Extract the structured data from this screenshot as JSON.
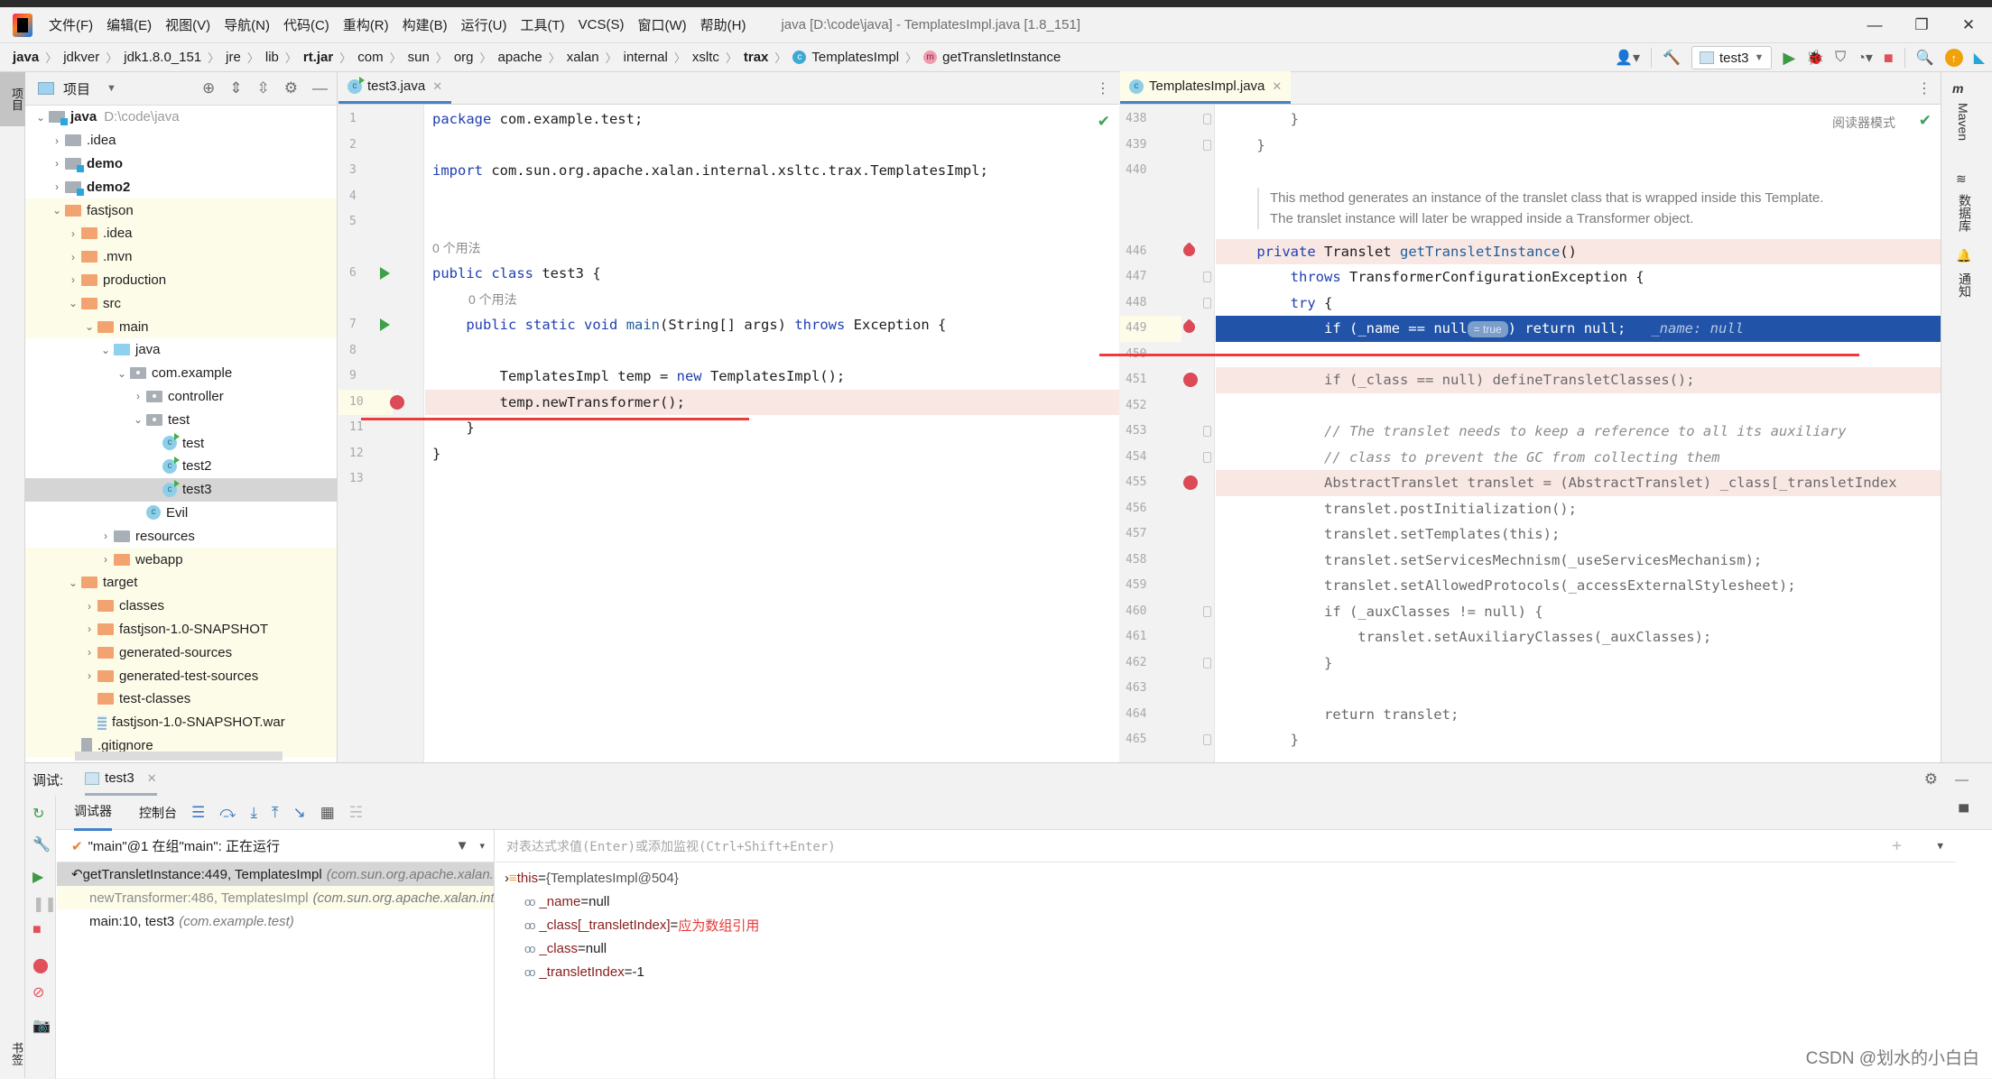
{
  "menubar": {
    "items": [
      "文件(F)",
      "编辑(E)",
      "视图(V)",
      "导航(N)",
      "代码(C)",
      "重构(R)",
      "构建(B)",
      "运行(U)",
      "工具(T)",
      "VCS(S)",
      "窗口(W)",
      "帮助(H)"
    ],
    "window_title": "java [D:\\code\\java] - TemplatesImpl.java [1.8_151]",
    "controls": {
      "minimize": "—",
      "restore": "❐",
      "close": "✕"
    }
  },
  "navbar": {
    "breadcrumbs": [
      "java",
      "jdkver",
      "jdk1.8.0_151",
      "jre",
      "lib",
      "rt.jar",
      "com",
      "sun",
      "org",
      "apache",
      "xalan",
      "internal",
      "xsltc",
      "trax"
    ],
    "class_crumb": "TemplatesImpl",
    "method_crumb": "getTransletInstance",
    "run_config": "test3"
  },
  "left_stripe": {
    "project_tab": "项目",
    "bookmarks_tab": "书签"
  },
  "project": {
    "header": "项目",
    "tree": [
      {
        "label": "java",
        "extra": "D:\\code\\java",
        "depth": 0,
        "icon": "module-folder",
        "open": true,
        "bold": true
      },
      {
        "label": ".idea",
        "depth": 1,
        "icon": "grey-folder",
        "open": false
      },
      {
        "label": "demo",
        "depth": 1,
        "icon": "module-folder",
        "open": false,
        "bold": true
      },
      {
        "label": "demo2",
        "depth": 1,
        "icon": "module-folder",
        "open": false,
        "bold": true
      },
      {
        "label": "fastjson",
        "depth": 1,
        "icon": "orange-folder",
        "open": true,
        "yellow": true
      },
      {
        "label": ".idea",
        "depth": 2,
        "icon": "orange-folder",
        "open": false,
        "yellow": true
      },
      {
        "label": ".mvn",
        "depth": 2,
        "icon": "orange-folder",
        "open": false,
        "yellow": true
      },
      {
        "label": "production",
        "depth": 2,
        "icon": "orange-folder",
        "open": false,
        "yellow": true
      },
      {
        "label": "src",
        "depth": 2,
        "icon": "orange-folder",
        "open": true,
        "yellow": true
      },
      {
        "label": "main",
        "depth": 3,
        "icon": "orange-folder",
        "open": true,
        "yellow": true
      },
      {
        "label": "java",
        "depth": 4,
        "icon": "blue-folder",
        "open": true
      },
      {
        "label": "com.example",
        "depth": 5,
        "icon": "package",
        "open": true
      },
      {
        "label": "controller",
        "depth": 6,
        "icon": "package",
        "open": false
      },
      {
        "label": "test",
        "depth": 6,
        "icon": "package",
        "open": true
      },
      {
        "label": "test",
        "depth": 7,
        "icon": "class-run"
      },
      {
        "label": "test2",
        "depth": 7,
        "icon": "class-run"
      },
      {
        "label": "test3",
        "depth": 7,
        "icon": "class-run",
        "selected": true
      },
      {
        "label": "Evil",
        "depth": 6,
        "icon": "class"
      },
      {
        "label": "resources",
        "depth": 4,
        "icon": "resources-folder",
        "open": false
      },
      {
        "label": "webapp",
        "depth": 4,
        "icon": "orange-folder",
        "open": false,
        "yellow": true
      },
      {
        "label": "target",
        "depth": 2,
        "icon": "orange-folder",
        "open": true,
        "yellow": true
      },
      {
        "label": "classes",
        "depth": 3,
        "icon": "orange-folder",
        "open": false,
        "yellow": true
      },
      {
        "label": "fastjson-1.0-SNAPSHOT",
        "depth": 3,
        "icon": "orange-folder",
        "open": false,
        "yellow": true
      },
      {
        "label": "generated-sources",
        "depth": 3,
        "icon": "orange-folder",
        "open": false,
        "yellow": true
      },
      {
        "label": "generated-test-sources",
        "depth": 3,
        "icon": "orange-folder",
        "open": false,
        "yellow": true
      },
      {
        "label": "test-classes",
        "depth": 3,
        "icon": "orange-folder",
        "yellow": true
      },
      {
        "label": "fastjson-1.0-SNAPSHOT.war",
        "depth": 3,
        "icon": "archive",
        "yellow": true
      },
      {
        "label": ".gitignore",
        "depth": 2,
        "icon": "ignored-file",
        "yellow": true
      }
    ]
  },
  "left_editor": {
    "tab": "test3.java",
    "usage_hint": "0 个用法",
    "lines": [
      {
        "n": "1",
        "code": "package com.example.test;"
      },
      {
        "n": "2",
        "code": ""
      },
      {
        "n": "3",
        "code": "import com.sun.org.apache.xalan.internal.xsltc.trax.TemplatesImpl;"
      },
      {
        "n": "4",
        "code": ""
      },
      {
        "n": "5",
        "code": ""
      },
      {
        "n": "",
        "hint": "0 个用法"
      },
      {
        "n": "6",
        "code": "public class test3 {"
      },
      {
        "n": "",
        "hint": "0 个用法"
      },
      {
        "n": "7",
        "code": "    public static void main(String[] args) throws Exception {"
      },
      {
        "n": "8",
        "code": ""
      },
      {
        "n": "9",
        "code": "        TemplatesImpl temp = new TemplatesImpl();"
      },
      {
        "n": "10",
        "code": "        temp.newTransformer();"
      },
      {
        "n": "11",
        "code": "    }"
      },
      {
        "n": "12",
        "code": "}"
      },
      {
        "n": "13",
        "code": ""
      }
    ]
  },
  "right_editor": {
    "tab": "TemplatesImpl.java",
    "reader_mode": "阅读器模式",
    "doc": [
      "This method generates an instance of the translet class that is wrapped inside this Template.",
      "The translet instance will later be wrapped inside a Transformer object."
    ],
    "lines": [
      {
        "n": "438",
        "code": "        }"
      },
      {
        "n": "439",
        "code": "    }"
      },
      {
        "n": "440",
        "code": ""
      },
      {
        "n": "446",
        "code": "    private Translet getTransletInstance()"
      },
      {
        "n": "447",
        "code": "        throws TransformerConfigurationException {"
      },
      {
        "n": "448",
        "code": "        try {"
      },
      {
        "n": "449",
        "code_pre": "            if (_name == null",
        "inlay": "= true",
        "code_post": ") return null;",
        "inline_value": "_name: null"
      },
      {
        "n": "450",
        "code": ""
      },
      {
        "n": "451",
        "code": "            if (_class == null) defineTransletClasses();"
      },
      {
        "n": "452",
        "code": ""
      },
      {
        "n": "453",
        "code": "            // The translet needs to keep a reference to all its auxiliary"
      },
      {
        "n": "454",
        "code": "            // class to prevent the GC from collecting them"
      },
      {
        "n": "455",
        "code": "            AbstractTranslet translet = (AbstractTranslet) _class[_transletIndex"
      },
      {
        "n": "456",
        "code": "            translet.postInitialization();"
      },
      {
        "n": "457",
        "code": "            translet.setTemplates(this);"
      },
      {
        "n": "458",
        "code": "            translet.setServicesMechnism(_useServicesMechanism);"
      },
      {
        "n": "459",
        "code": "            translet.setAllowedProtocols(_accessExternalStylesheet);"
      },
      {
        "n": "460",
        "code": "            if (_auxClasses != null) {"
      },
      {
        "n": "461",
        "code": "                translet.setAuxiliaryClasses(_auxClasses);"
      },
      {
        "n": "462",
        "code": "            }"
      },
      {
        "n": "463",
        "code": ""
      },
      {
        "n": "464",
        "code": "            return translet;"
      },
      {
        "n": "465",
        "code": "        }"
      }
    ]
  },
  "right_stripe": {
    "maven": "Maven",
    "database": "数据库",
    "notifications": "通知"
  },
  "debug": {
    "label": "调试:",
    "session_tab": "test3",
    "tabs": [
      "调试器",
      "控制台"
    ],
    "thread": "\"main\"@1 在组\"main\": 正在运行",
    "frames": [
      {
        "method": "getTransletInstance:449, TemplatesImpl",
        "pkg": "(com.sun.org.apache.xalan.internal.xsltc.trax)",
        "selected": true
      },
      {
        "method": "newTransformer:486, TemplatesImpl",
        "pkg": "(com.sun.org.apache.xalan.internal.xsltc.trax)",
        "library": true
      },
      {
        "method": "main:10, test3",
        "pkg": "(com.example.test)"
      }
    ],
    "eval_placeholder": "对表达式求值(Enter)或添加监视(Ctrl+Shift+Enter)",
    "variables": [
      {
        "name": "this",
        "value": "{TemplatesImpl@504}",
        "kind": "object"
      },
      {
        "name": "_name",
        "value": "null",
        "kind": "watch"
      },
      {
        "name": "_class[_transletIndex]",
        "value": "应为数组引用",
        "kind": "watch",
        "error": true
      },
      {
        "name": "_class",
        "value": "null",
        "kind": "watch"
      },
      {
        "name": "_transletIndex",
        "value": "-1",
        "kind": "watch"
      }
    ]
  },
  "watermark": "CSDN @划水的小白白"
}
